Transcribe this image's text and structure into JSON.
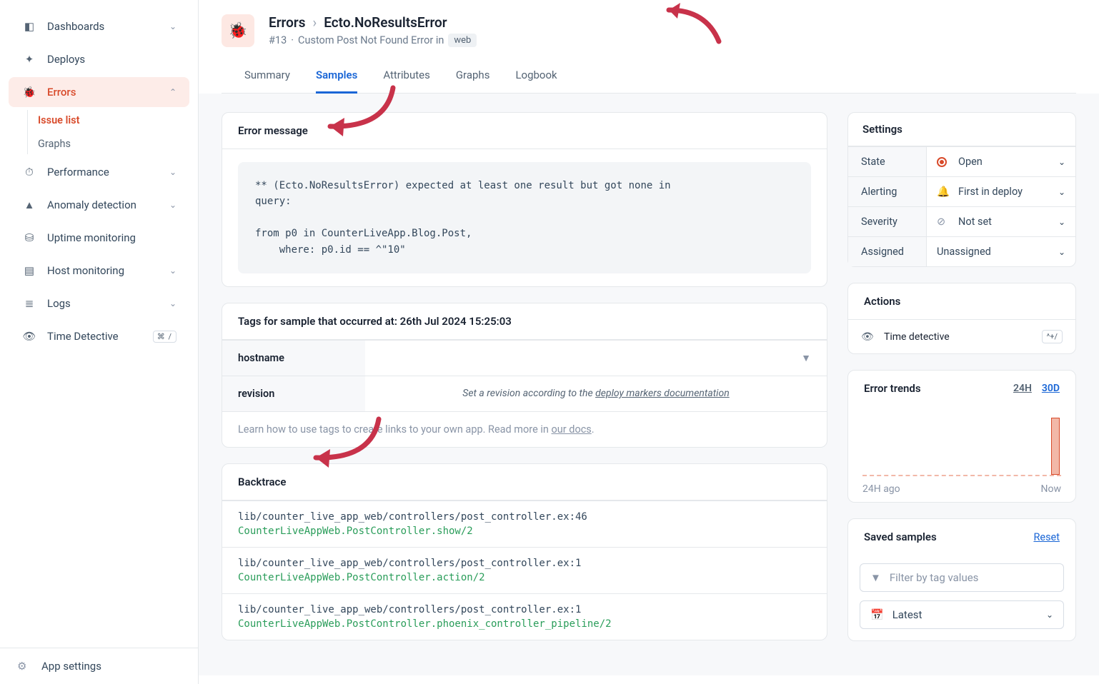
{
  "sidebar": {
    "items": [
      {
        "label": "Dashboards",
        "expandable": true,
        "icon": "dashboard"
      },
      {
        "label": "Deploys",
        "expandable": false,
        "icon": "rocket"
      },
      {
        "label": "Errors",
        "expandable": true,
        "icon": "bug",
        "active": true,
        "sub": [
          {
            "label": "Issue list",
            "active": true
          },
          {
            "label": "Graphs",
            "active": false
          }
        ]
      },
      {
        "label": "Performance",
        "expandable": true,
        "icon": "gauge"
      },
      {
        "label": "Anomaly detection",
        "expandable": true,
        "icon": "alert"
      },
      {
        "label": "Uptime monitoring",
        "expandable": false,
        "icon": "db"
      },
      {
        "label": "Host monitoring",
        "expandable": true,
        "icon": "server"
      },
      {
        "label": "Logs",
        "expandable": true,
        "icon": "list"
      },
      {
        "label": "Time Detective",
        "expandable": false,
        "icon": "detective",
        "kbd": "⌘ /"
      }
    ],
    "settings_label": "App settings"
  },
  "header": {
    "crumb_root": "Errors",
    "crumb_current": "Ecto.NoResultsError",
    "issue_number": "#13",
    "subtitle_mid": "Custom Post Not Found Error in",
    "pill": "web"
  },
  "tabs": [
    "Summary",
    "Samples",
    "Attributes",
    "Graphs",
    "Logbook"
  ],
  "active_tab": 1,
  "error_message": {
    "title": "Error message",
    "body": "** (Ecto.NoResultsError) expected at least one result but got none in\nquery:\n\nfrom p0 in CounterLiveApp.Blog.Post,\n    where: p0.id == ^\"10\""
  },
  "tags": {
    "title": "Tags for sample that occurred at: 26th Jul 2024 15:25:03",
    "rows": [
      {
        "key": "hostname",
        "val": ""
      },
      {
        "key": "revision",
        "val_prefix": "Set a revision according to the ",
        "val_link": "deploy markers documentation"
      }
    ],
    "docs_prefix": "Learn how to use tags to create links to your own app. Read more in ",
    "docs_link": "our docs",
    "docs_suffix": "."
  },
  "backtrace": {
    "title": "Backtrace",
    "items": [
      {
        "path": "lib/counter_live_app_web/controllers/post_controller.ex:46",
        "fn": "CounterLiveAppWeb.PostController.show/2"
      },
      {
        "path": "lib/counter_live_app_web/controllers/post_controller.ex:1",
        "fn": "CounterLiveAppWeb.PostController.action/2"
      },
      {
        "path": "lib/counter_live_app_web/controllers/post_controller.ex:1",
        "fn": "CounterLiveAppWeb.PostController.phoenix_controller_pipeline/2"
      }
    ]
  },
  "settings": {
    "title": "Settings",
    "rows": [
      {
        "label": "State",
        "value": "Open",
        "icon": "open"
      },
      {
        "label": "Alerting",
        "value": "First in deploy",
        "icon": "bell"
      },
      {
        "label": "Severity",
        "value": "Not set",
        "icon": "none"
      },
      {
        "label": "Assigned",
        "value": "Unassigned",
        "icon": ""
      }
    ]
  },
  "actions": {
    "title": "Actions",
    "time_detective": "Time detective",
    "kbd": "^+/"
  },
  "trends": {
    "title": "Error trends",
    "range_24h": "24H",
    "range_30d": "30D",
    "label_left": "24H ago",
    "label_right": "Now"
  },
  "saved": {
    "title": "Saved samples",
    "reset": "Reset",
    "filter_placeholder": "Filter by tag values",
    "latest": "Latest"
  }
}
